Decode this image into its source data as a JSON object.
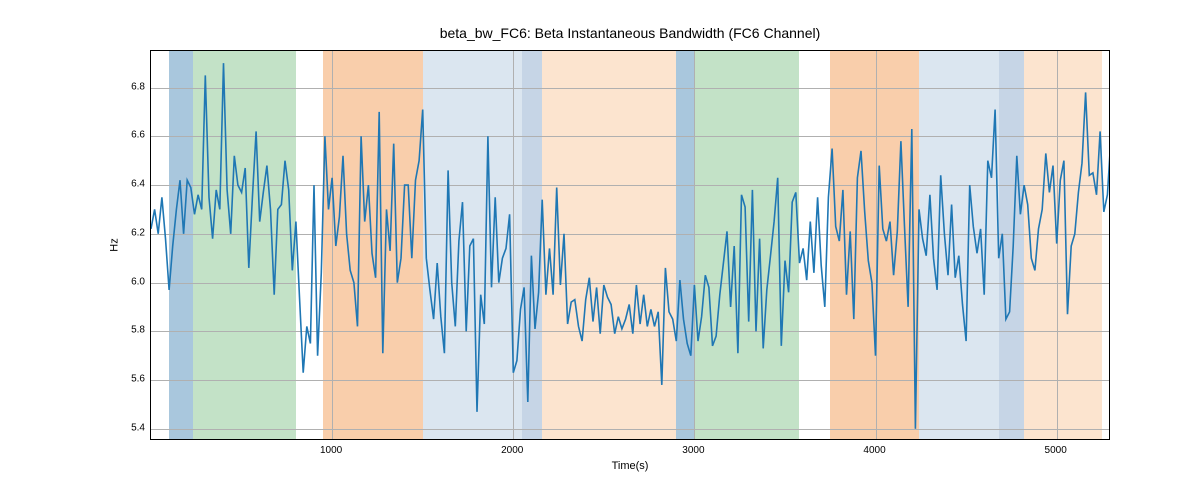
{
  "chart_data": {
    "type": "line",
    "title": "beta_bw_FC6: Beta Instantaneous Bandwidth (FC6 Channel)",
    "xlabel": "Time(s)",
    "ylabel": "Hz",
    "xlim": [
      0,
      5300
    ],
    "ylim": [
      5.35,
      6.95
    ],
    "xticks": [
      1000,
      2000,
      3000,
      4000,
      5000
    ],
    "yticks": [
      5.4,
      5.6,
      5.8,
      6.0,
      6.2,
      6.4,
      6.6,
      6.8
    ],
    "bands": [
      {
        "x0": 100,
        "x1": 230,
        "color": "#a9c7dd"
      },
      {
        "x0": 230,
        "x1": 800,
        "color": "#c3e2c7"
      },
      {
        "x0": 950,
        "x1": 1500,
        "color": "#f9ceab"
      },
      {
        "x0": 1500,
        "x1": 2050,
        "color": "#dbe6f0"
      },
      {
        "x0": 2050,
        "x1": 2160,
        "color": "#c6d5e6"
      },
      {
        "x0": 2160,
        "x1": 2900,
        "color": "#fce4cf"
      },
      {
        "x0": 2900,
        "x1": 3000,
        "color": "#a9c7dd"
      },
      {
        "x0": 3000,
        "x1": 3580,
        "color": "#c3e2c7"
      },
      {
        "x0": 3750,
        "x1": 4240,
        "color": "#f9ceab"
      },
      {
        "x0": 4240,
        "x1": 4680,
        "color": "#dbe6f0"
      },
      {
        "x0": 4680,
        "x1": 4820,
        "color": "#c6d5e6"
      },
      {
        "x0": 4820,
        "x1": 5250,
        "color": "#fce4cf"
      }
    ],
    "line_color": "#1f77b4",
    "series": [
      {
        "name": "beta_bw_FC6",
        "x_step": 20,
        "x_start": 0,
        "values": [
          6.22,
          6.3,
          6.2,
          6.35,
          6.18,
          5.97,
          6.15,
          6.3,
          6.42,
          6.2,
          6.42,
          6.39,
          6.28,
          6.36,
          6.3,
          6.85,
          6.35,
          6.18,
          6.38,
          6.3,
          6.9,
          6.38,
          6.2,
          6.52,
          6.4,
          6.37,
          6.47,
          6.06,
          6.35,
          6.62,
          6.25,
          6.37,
          6.48,
          6.3,
          5.95,
          6.3,
          6.32,
          6.5,
          6.38,
          6.05,
          6.25,
          5.94,
          5.63,
          5.82,
          5.75,
          6.4,
          5.7,
          6.04,
          6.6,
          6.3,
          6.43,
          6.15,
          6.27,
          6.52,
          6.2,
          6.05,
          6.0,
          5.82,
          6.6,
          6.25,
          6.4,
          6.12,
          6.02,
          6.7,
          5.71,
          6.3,
          6.13,
          6.57,
          6.0,
          6.1,
          6.4,
          6.4,
          6.1,
          6.42,
          6.5,
          6.71,
          6.1,
          5.97,
          5.85,
          6.08,
          5.86,
          5.71,
          6.46,
          6.0,
          5.82,
          6.17,
          6.33,
          5.8,
          6.15,
          6.18,
          5.47,
          5.95,
          5.83,
          6.6,
          5.98,
          6.35,
          6.0,
          6.1,
          6.14,
          6.28,
          5.63,
          5.68,
          5.89,
          5.98,
          5.51,
          6.11,
          5.81,
          5.96,
          6.34,
          5.95,
          6.14,
          5.95,
          6.39,
          5.99,
          6.2,
          5.83,
          5.92,
          5.93,
          5.82,
          5.76,
          5.93,
          6.02,
          5.84,
          5.98,
          5.79,
          5.99,
          5.94,
          5.91,
          5.79,
          5.86,
          5.81,
          5.85,
          5.91,
          5.79,
          5.99,
          5.83,
          5.95,
          5.82,
          5.89,
          5.82,
          5.88,
          5.58,
          6.06,
          5.88,
          5.85,
          5.76,
          6.01,
          5.85,
          5.75,
          5.7,
          5.99,
          5.76,
          5.86,
          6.03,
          5.98,
          5.74,
          5.78,
          5.95,
          6.08,
          6.21,
          5.9,
          6.15,
          5.71,
          6.36,
          6.31,
          5.84,
          6.38,
          5.8,
          6.18,
          5.73,
          5.97,
          6.11,
          6.25,
          6.43,
          5.74,
          6.09,
          5.96,
          6.33,
          6.37,
          6.08,
          6.14,
          6.01,
          6.25,
          6.04,
          6.35,
          6.07,
          5.9,
          6.35,
          6.55,
          6.23,
          6.17,
          6.38,
          5.95,
          6.21,
          5.85,
          6.43,
          6.54,
          6.29,
          6.09,
          6.0,
          5.7,
          6.48,
          6.22,
          6.17,
          6.25,
          6.03,
          6.21,
          6.58,
          6.23,
          5.9,
          6.63,
          5.4,
          6.3,
          6.18,
          6.11,
          6.36,
          6.1,
          5.97,
          6.44,
          6.2,
          6.03,
          6.32,
          6.02,
          6.11,
          5.91,
          5.76,
          6.4,
          6.23,
          6.12,
          6.22,
          5.95,
          6.5,
          6.43,
          6.71,
          6.1,
          6.2,
          5.85,
          5.88,
          6.15,
          6.52,
          6.28,
          6.4,
          6.32,
          6.1,
          6.05,
          6.22,
          6.3,
          6.53,
          6.37,
          6.48,
          6.16,
          6.42,
          6.5,
          5.87,
          6.15,
          6.2,
          6.37,
          6.49,
          6.78,
          6.44,
          6.45,
          6.36,
          6.62,
          6.29,
          6.36,
          6.6
        ]
      }
    ]
  }
}
